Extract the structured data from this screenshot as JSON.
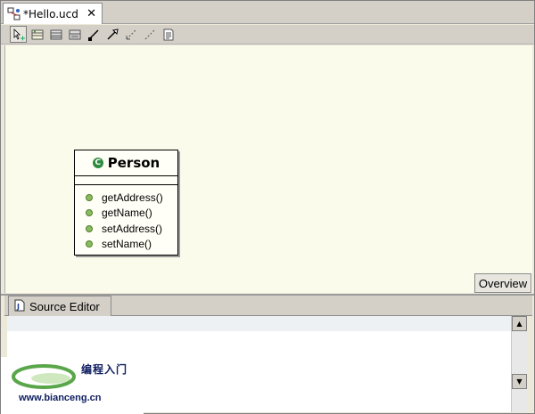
{
  "editor_tab": {
    "title": "*Hello.ucd",
    "close_glyph": "✕",
    "icon": "uml-diagram-icon"
  },
  "toolbar": {
    "tools": [
      {
        "name": "select-tool-icon",
        "active": true
      },
      {
        "name": "class-tool-icon",
        "active": false
      },
      {
        "name": "interface-tool-icon",
        "active": false
      },
      {
        "name": "enum-tool-icon",
        "active": false
      },
      {
        "name": "association-tool-icon",
        "active": false
      },
      {
        "name": "generalization-tool-icon",
        "active": false
      },
      {
        "name": "dependency-tool-icon",
        "active": false
      },
      {
        "name": "realization-tool-icon",
        "active": false
      },
      {
        "name": "note-tool-icon",
        "active": false
      }
    ]
  },
  "diagram": {
    "class": {
      "stereotype_glyph": "C",
      "name": "Person",
      "operations": [
        "getAddress()",
        "getName()",
        "setAddress()",
        "setName()"
      ]
    },
    "overview_label": "Overview"
  },
  "bottom_pane": {
    "tab_label": "Source Editor",
    "tab_icon": "java-file-icon"
  },
  "watermark": {
    "chinese_text": "编程入门",
    "url": "www.bianceng.cn"
  },
  "colors": {
    "canvas_bg": "#fbfbec",
    "class_icon": "#2e8b3e",
    "operation_dot": "#8bbb5f"
  }
}
